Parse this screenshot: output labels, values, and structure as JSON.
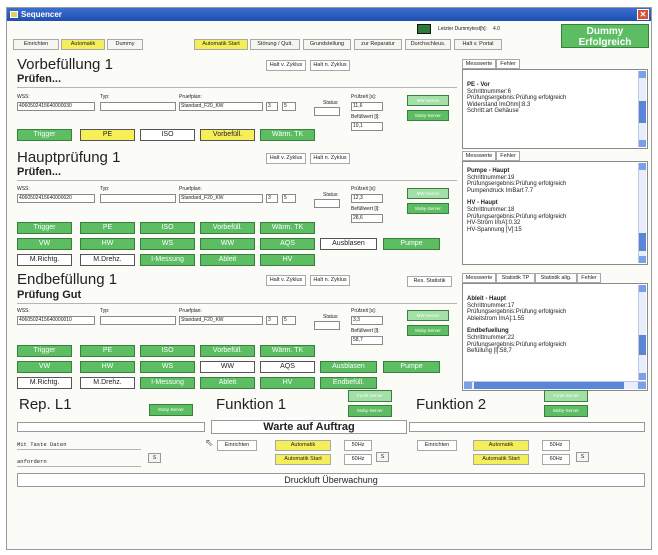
{
  "window": {
    "title": "Sequencer"
  },
  "topbar": {
    "tabs": [
      "Einrichten",
      "Automatik",
      "Dummy",
      "Automatik Start",
      "Störung / Quit.",
      "Grundstellung",
      "zur Reparatur",
      "Durchschleus.",
      "Halt v. Portal"
    ],
    "last_dummytest_label": "Letzter Dummytest[h]:",
    "last_dummytest_value": "4.0",
    "status_badge": "Dummy Erfolgreich"
  },
  "colors": {
    "green": "#5cbd63",
    "yellow": "#f6ef58",
    "title_blue": "#1f4fb0"
  },
  "sections": [
    {
      "title": "Vorbefüllung 1",
      "status": "Prüfen...",
      "halt_v": "Halt v. Zyklus",
      "halt_n": "Halt n. Zyklus",
      "wss_label": "WSS:",
      "wss": "4060502415640000030",
      "typ_label": "Typ:",
      "typ": "",
      "pp_label": "Pruefplan:",
      "pp": "Standard_F20_KW",
      "n1": "3",
      "n2": "5",
      "status_label": "Status:",
      "pz_label": "Prüfzeit [s]:",
      "pz": "11,6",
      "bef_label": "Befüllwert [l]:",
      "bef": "10,1",
      "mw_server": "MW-Server",
      "moby_server": "Moby-Server",
      "steps": [
        "Trigger",
        "PE",
        "ISO",
        "Vorbefüll.",
        "Wärm. TK"
      ]
    },
    {
      "title": "Hauptprüfung 1",
      "status": "Prüfen...",
      "halt_v": "Halt v. Zyklus",
      "halt_n": "Halt n. Zyklus",
      "wss_label": "WSS:",
      "wss": "4060502415640000020",
      "typ_label": "Typ:",
      "typ": "",
      "pp_label": "Pruefplan:",
      "pp": "Standard_F20_KW",
      "n1": "3",
      "n2": "5",
      "status_label": "Status:",
      "pz_label": "Prüfzeit [s]:",
      "pz": "12,3",
      "bef_label": "Befüllwert [l]:",
      "bef": "28,6",
      "mw_server": "MW-Server",
      "moby_server": "Moby-Server",
      "rows": [
        [
          "Trigger",
          "PE",
          "ISO",
          "Vorbefüll.",
          "Wärm. TK"
        ],
        [
          "VW",
          "HW",
          "WS",
          "WW",
          "AQS",
          "Ausblasen",
          "Pumpe"
        ],
        [
          "M.Richtg.",
          "M.Drehz.",
          "I-Messung",
          "Ableit",
          "HV"
        ]
      ]
    },
    {
      "title": "Endbefüllung 1",
      "status": "Prüfung Gut",
      "halt_v": "Halt v. Zyklus",
      "halt_n": "Halt n. Zyklus",
      "reset_stat": "Res. Statistik",
      "wss_label": "WSS:",
      "wss": "4060502415640000010",
      "typ_label": "Typ:",
      "typ": "",
      "pp_label": "Pruefplan:",
      "pp": "Standard_F20_KW",
      "n1": "3",
      "n2": "5",
      "status_label": "Status:",
      "pz_label": "Prüfzeit [s]:",
      "pz": "3,3",
      "bef_label": "Befüllwert [l]:",
      "bef": "58,7",
      "mw_server": "MW-Server",
      "moby_server": "Moby-Server",
      "rows": [
        [
          "Trigger",
          "PE",
          "ISO",
          "Vorbefüll.",
          "Wärm. TK"
        ],
        [
          "VW",
          "HW",
          "WS",
          "WW",
          "AQS",
          "Ausblasen",
          "Pumpe"
        ],
        [
          "M.Richtg.",
          "M.Drehz.",
          "I-Messung",
          "Ableit",
          "HV",
          "Endbefüll."
        ]
      ]
    }
  ],
  "panels": [
    {
      "tabs": [
        "Messwerte",
        "Fehler"
      ],
      "groups": [
        {
          "title": "PE - Vor",
          "lines": [
            "Schrittnummer:6",
            "Prüfungsergebnis:Prüfung erfolgreich",
            "Widerstand ImOhm]:8.3",
            "Schritt:art Gehäuse"
          ]
        }
      ]
    },
    {
      "tabs": [
        "Messwerte",
        "Fehler"
      ],
      "groups": [
        {
          "title": "Pumpe - Haupt",
          "lines": [
            "Schrittnummer:19",
            "Prüfungsergebnis:Prüfung erfolgreich",
            "Pumpendruck ImBarl:7.7"
          ]
        },
        {
          "title": "HV - Haupt",
          "lines": [
            "Schrittnummer:18",
            "Prüfungsergebnis:Prüfung erfolgreich",
            "HV-Strom ImA]:0.32",
            "HV-Spannung [V]:15"
          ]
        }
      ]
    },
    {
      "tabs": [
        "Messwerte",
        "Statistik TP",
        "Statistik allg.",
        "Fehler"
      ],
      "groups": [
        {
          "title": "Ableit - Haupt",
          "lines": [
            "Schrittnummer:17",
            "Prüfungsergebnis:Prüfung erfolgreich",
            "Ableitstrom ImA]:1.55"
          ]
        },
        {
          "title": "Endbefuellung",
          "lines": [
            "Schrittnummer:22",
            "Prüfungsergebnis:Prüfung erfolgreich",
            "Befüllung [l]:58,7"
          ]
        }
      ]
    }
  ],
  "bottom": {
    "rep_title": "Rep. L1",
    "rep_moby": "Moby-Server",
    "rep_lines": [
      "Mit Taste Daten",
      "anfordern"
    ],
    "rep_s": "S",
    "funktion1": {
      "title": "Funktion 1",
      "funkt_server": "Funkt.Server",
      "moby": "Moby-Server",
      "einrichten": "Einrichten",
      "automatik": "Automatik",
      "hz1": "50Hz",
      "auto_start": "Automatik Start",
      "hz2": "60Hz",
      "s": "S"
    },
    "funktion2": {
      "title": "Funktion 2",
      "funkt_server": "Funkt.Server",
      "moby": "Moby-Server",
      "einrichten": "Einrichten",
      "automatik": "Automatik",
      "hz1": "50Hz",
      "auto_start": "Automatik Start",
      "hz2": "60Hz",
      "s": "S"
    },
    "warte": "Warte auf Auftrag",
    "druckluft": "Druckluft Überwachung"
  }
}
